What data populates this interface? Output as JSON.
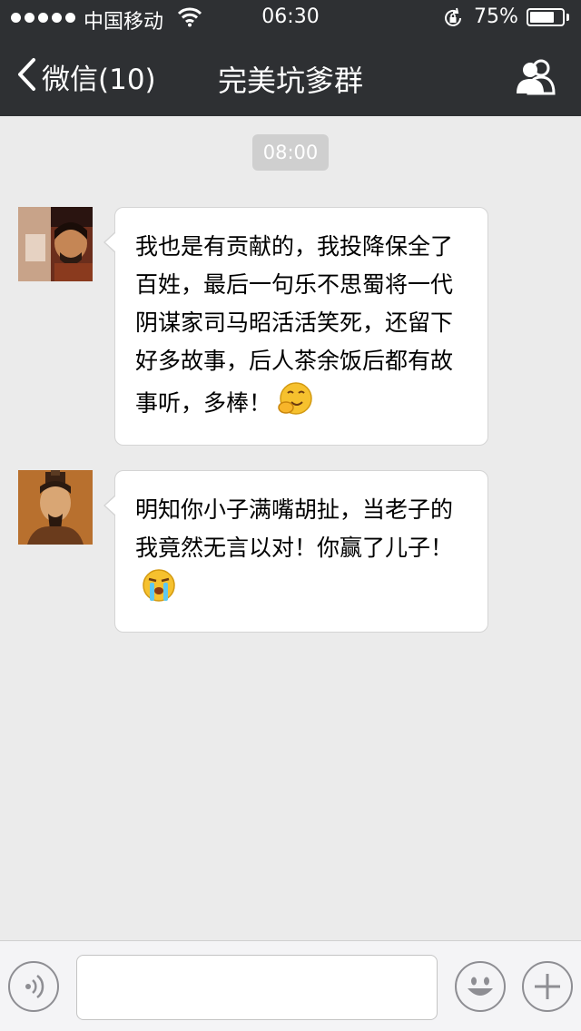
{
  "status_bar": {
    "carrier": "中国移动",
    "time": "06:30",
    "battery_percent": "75%",
    "battery_level": 0.75
  },
  "nav": {
    "back_label": "微信(10)",
    "title": "完美坑爹群",
    "members_icon": "group-members-icon"
  },
  "chat": {
    "timestamp": "08:00",
    "messages": [
      {
        "sender_avatar": "avatar-liu-shan",
        "text": "我也是有贡献的，我投降保全了百姓，最后一句乐不思蜀将一代阴谋家司马昭活活笑死，还留下好多故事，后人茶余饭后都有故事听，多棒！",
        "emoji": "shy-grin-emoji"
      },
      {
        "sender_avatar": "avatar-liu-bei",
        "text": "明知你小子满嘴胡扯，当老子的我竟然无言以对！你赢了儿子！",
        "emoji": "crying-emoji"
      }
    ]
  },
  "input_bar": {
    "voice_icon": "voice-icon",
    "text_value": "",
    "emoji_icon": "smiley-icon",
    "more_icon": "plus-icon"
  },
  "colors": {
    "topbar": "#2e3033",
    "chat_bg": "#ebebeb",
    "bubble": "#ffffff",
    "timestamp_bg": "#cfcfcf"
  }
}
